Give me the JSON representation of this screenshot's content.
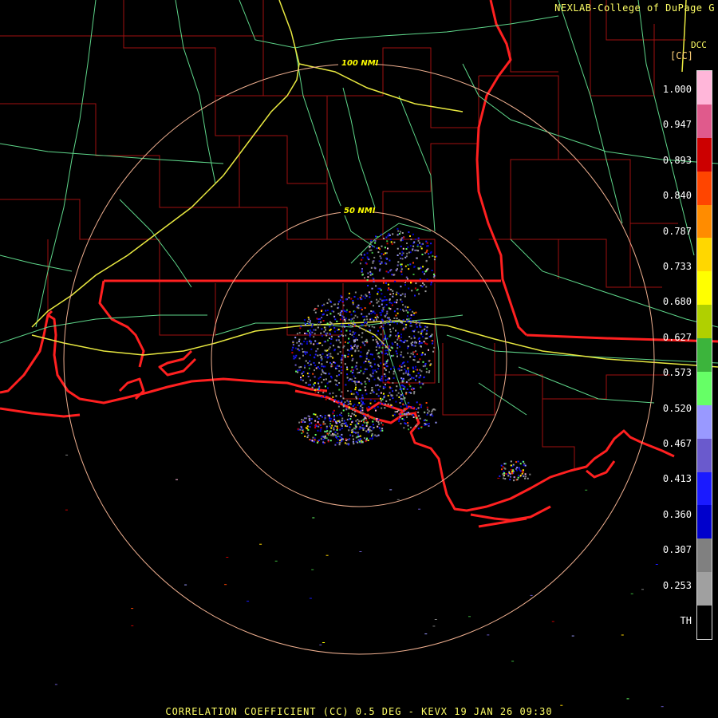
{
  "header": {
    "credit": "NEXLAB-College of DuPage",
    "credit_mark": "G",
    "station_code": "DCC"
  },
  "colorbar": {
    "unit": "[CC]",
    "ticks": [
      "1.000",
      "0.947",
      "0.893",
      "0.840",
      "0.787",
      "0.733",
      "0.680",
      "0.627",
      "0.573",
      "0.520",
      "0.467",
      "0.413",
      "0.360",
      "0.307",
      "0.253",
      "TH"
    ],
    "colors": [
      "#ffb6d9",
      "#e05a8c",
      "#cc0000",
      "#ff4500",
      "#ff8c00",
      "#ffd700",
      "#ffff00",
      "#b0d000",
      "#3cb43c",
      "#66ff66",
      "#9999ff",
      "#6a5acd",
      "#1a1aff",
      "#0000cc",
      "#808080",
      "#a0a0a0",
      "#000000"
    ]
  },
  "map": {
    "rings": [
      {
        "label": "100 NMI"
      },
      {
        "label": "50 NMI"
      }
    ],
    "colors": {
      "background": "#000000",
      "county_lines": "#a01010",
      "state_lines": "#ff2020",
      "highways": "#e8e840",
      "roads": "#5ed68a",
      "range_rings": "#f0b090"
    }
  },
  "footer": {
    "title": "CORRELATION COEFFICIENT (CC) 0.5 DEG - KEVX 19 JAN 26 09:30"
  }
}
